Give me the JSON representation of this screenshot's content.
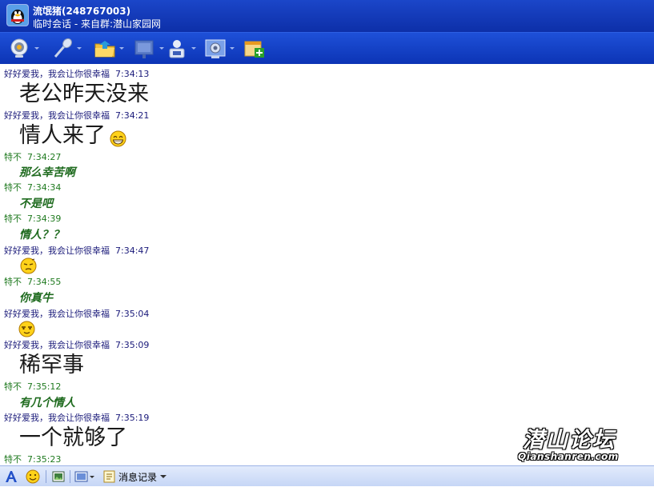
{
  "window": {
    "title": "流氓猪(248767003)",
    "subtitle": "临时会话 - 来自群:潜山家园网"
  },
  "toolbar": {
    "items": [
      {
        "name": "video-icon"
      },
      {
        "name": "microphone-icon"
      },
      {
        "name": "folder-icon"
      },
      {
        "name": "whiteboard-icon"
      },
      {
        "name": "remote-assist-icon"
      },
      {
        "name": "app-sharing-icon"
      },
      {
        "name": "add-feature-icon"
      }
    ]
  },
  "messages": [
    {
      "sender": "好好爱我，我会让你很幸福",
      "time": "7:34:13",
      "kind": "big",
      "text": "老公昨天没来"
    },
    {
      "sender": "好好爱我，我会让你很幸福",
      "time": "7:34:21",
      "kind": "big",
      "text": "情人来了",
      "emoticon": "grin-emoticon"
    },
    {
      "sender": "特不",
      "time": "7:34:27",
      "kind": "green",
      "text": "那么幸苦啊"
    },
    {
      "sender": "特不",
      "time": "7:34:34",
      "kind": "green",
      "text": "不是吧"
    },
    {
      "sender": "特不",
      "time": "7:34:39",
      "kind": "green",
      "text": "情人？？"
    },
    {
      "sender": "好好爱我，我会让你很幸福",
      "time": "7:34:47",
      "kind": "emoticon",
      "emoticon": "sleepy-emoticon"
    },
    {
      "sender": "特不",
      "time": "7:34:55",
      "kind": "green",
      "text": "你真牛"
    },
    {
      "sender": "好好爱我，我会让你很幸福",
      "time": "7:35:04",
      "kind": "emoticon",
      "emoticon": "smug-emoticon"
    },
    {
      "sender": "好好爱我，我会让你很幸福",
      "time": "7:35:09",
      "kind": "big",
      "text": "稀罕事"
    },
    {
      "sender": "特不",
      "time": "7:35:12",
      "kind": "green",
      "text": "有几个情人"
    },
    {
      "sender": "好好爱我，我会让你很幸福",
      "time": "7:35:19",
      "kind": "big",
      "text": "一个就够了"
    },
    {
      "sender": "特不",
      "time": "7:35:23"
    }
  ],
  "watermark": {
    "chinese": "潜山论坛",
    "domain": "Qianshanren.com"
  },
  "bottombar": {
    "history_label": "消息记录"
  },
  "colors": {
    "title_bar": "#1b46c9",
    "toolbar": "#1e50d8",
    "peer_text": "#1f6b1f",
    "self_header": "#1a1a7a"
  }
}
